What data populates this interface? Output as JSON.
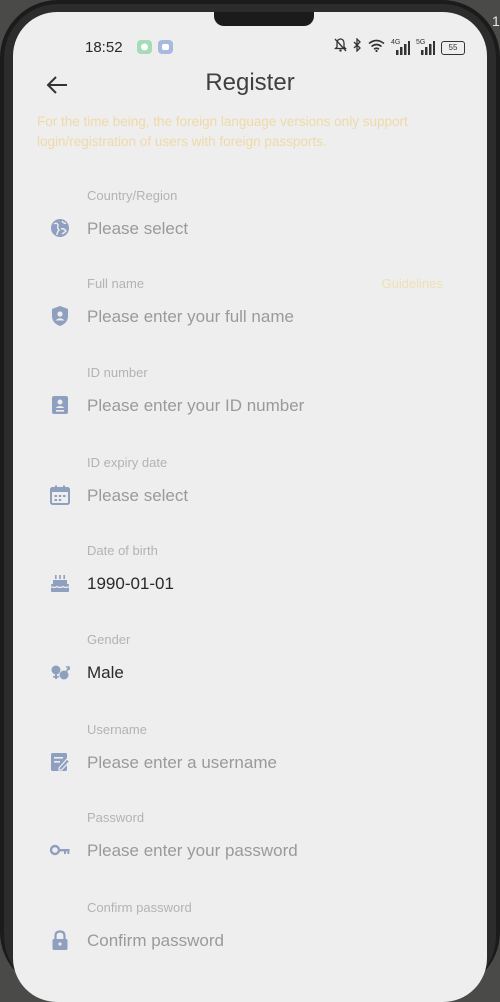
{
  "edge_digit": "1",
  "status_bar": {
    "time": "18:52",
    "network_1": "4G",
    "network_2": "5G",
    "battery": "55",
    "app_icons": [
      "chat-icon",
      "message-icon"
    ],
    "icons": [
      "mute-bell-icon",
      "bluetooth-icon",
      "wifi-icon",
      "signal-icon",
      "signal-icon",
      "battery-icon"
    ]
  },
  "header": {
    "title": "Register",
    "back_icon": "arrow-left-icon"
  },
  "notice": "For the time being, the foreign language versions only support login/registration of users with foreign passports.",
  "colors": {
    "notice": "#f0d9a8",
    "icon": "#8e9fbf",
    "label": "#b3b3b3",
    "placeholder": "#9a9a9a",
    "value": "#2a2a2a",
    "background": "#eeeeee"
  },
  "form": {
    "country": {
      "label": "Country/Region",
      "placeholder": "Please select",
      "icon": "globe-icon"
    },
    "full_name": {
      "label": "Full name",
      "placeholder": "Please enter your full name",
      "aside": "Guidelines",
      "icon": "id-shield-icon"
    },
    "id_number": {
      "label": "ID number",
      "placeholder": "Please enter your ID number",
      "icon": "id-card-icon"
    },
    "id_expiry": {
      "label": "ID expiry date",
      "placeholder": "Please select",
      "icon": "calendar-icon"
    },
    "dob": {
      "label": "Date of birth",
      "value": "1990-01-01",
      "icon": "birthday-cake-icon"
    },
    "gender": {
      "label": "Gender",
      "value": "Male",
      "icon": "gender-icon"
    },
    "username": {
      "label": "Username",
      "placeholder": "Please enter a username",
      "icon": "edit-note-icon"
    },
    "password": {
      "label": "Password",
      "placeholder": "Please enter your password",
      "icon": "key-icon"
    },
    "confirm_password": {
      "label": "Confirm password",
      "placeholder": "Confirm password",
      "icon": "lock-icon"
    }
  }
}
